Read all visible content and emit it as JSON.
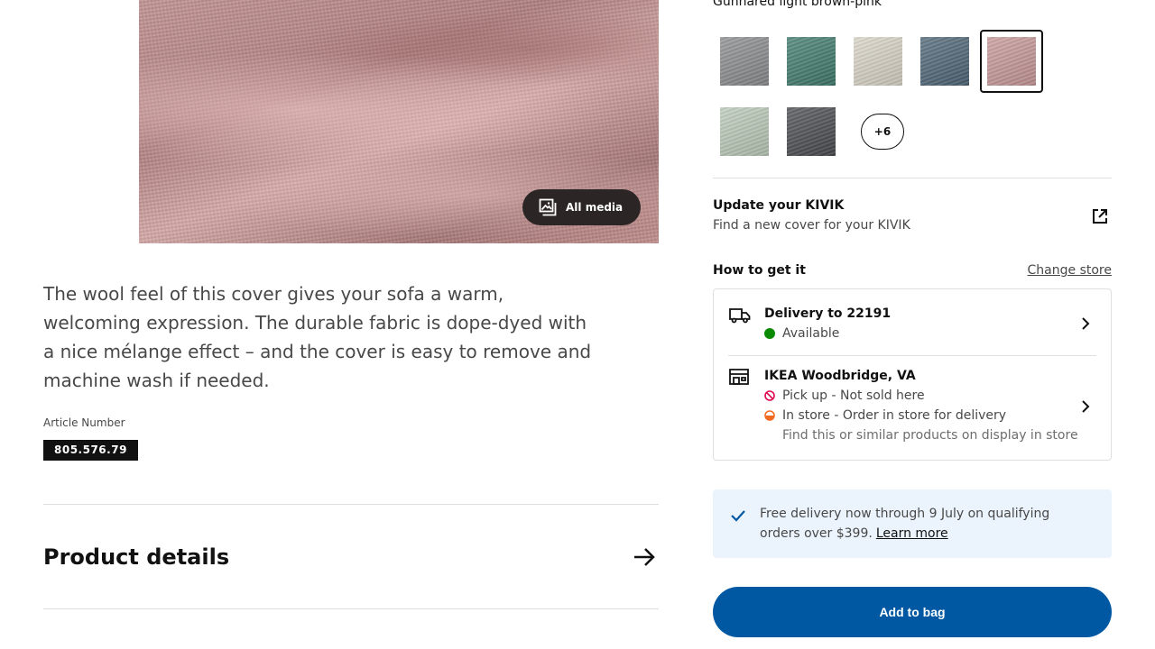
{
  "media": {
    "all_media_label": "All media",
    "image_icon": "image-gallery-icon"
  },
  "product": {
    "description": "The wool feel of this cover gives your sofa a warm, welcoming expression. The durable fabric is dope-dyed with a nice mélange effect – and the cover is easy to remove and machine wash if needed.",
    "article_label": "Article Number",
    "article_number": "805.576.79",
    "details_heading": "Product details",
    "details_icon": "arrow-right-icon"
  },
  "colors": {
    "selected_name": "Gunnared light brown-pink",
    "swatches": [
      {
        "name": "grey",
        "color": "#8a8b8d",
        "selected": false
      },
      {
        "name": "dark-green",
        "color": "#3f7a6b",
        "selected": false
      },
      {
        "name": "beige",
        "color": "#d8d3c6",
        "selected": false
      },
      {
        "name": "blue",
        "color": "#4d6475",
        "selected": false
      },
      {
        "name": "light-brown-pink",
        "color": "#c79898",
        "selected": true
      },
      {
        "name": "light-green",
        "color": "#b9c9b7",
        "selected": false
      },
      {
        "name": "dark-grey",
        "color": "#4a4b4f",
        "selected": false
      }
    ],
    "more_label": "+6"
  },
  "update": {
    "title": "Update your KIVIK",
    "subtitle": "Find a new cover for your KIVIK",
    "icon": "external-link-icon"
  },
  "availability": {
    "heading": "How to get it",
    "change_store_label": "Change store",
    "delivery": {
      "title": "Delivery to 22191",
      "status": "Available",
      "status_color": "#0a8a00",
      "icon": "truck-icon"
    },
    "store": {
      "title": "IKEA Woodbridge, VA",
      "pickup_status": "Pick up - Not sold here",
      "pickup_color": "#e00751",
      "instore_status": "In store - Order in store for delivery",
      "instore_color": "#f26a21",
      "instore_sub": "Find this or similar products on display in store",
      "icon": "store-icon"
    }
  },
  "promo": {
    "text": "Free delivery now through 9 July on qualifying orders over $399.",
    "link_label": "Learn more",
    "icon": "checkmark-icon",
    "accent": "#0058a3"
  },
  "cart": {
    "add_label": "Add to bag",
    "button_color": "#0058a3"
  }
}
